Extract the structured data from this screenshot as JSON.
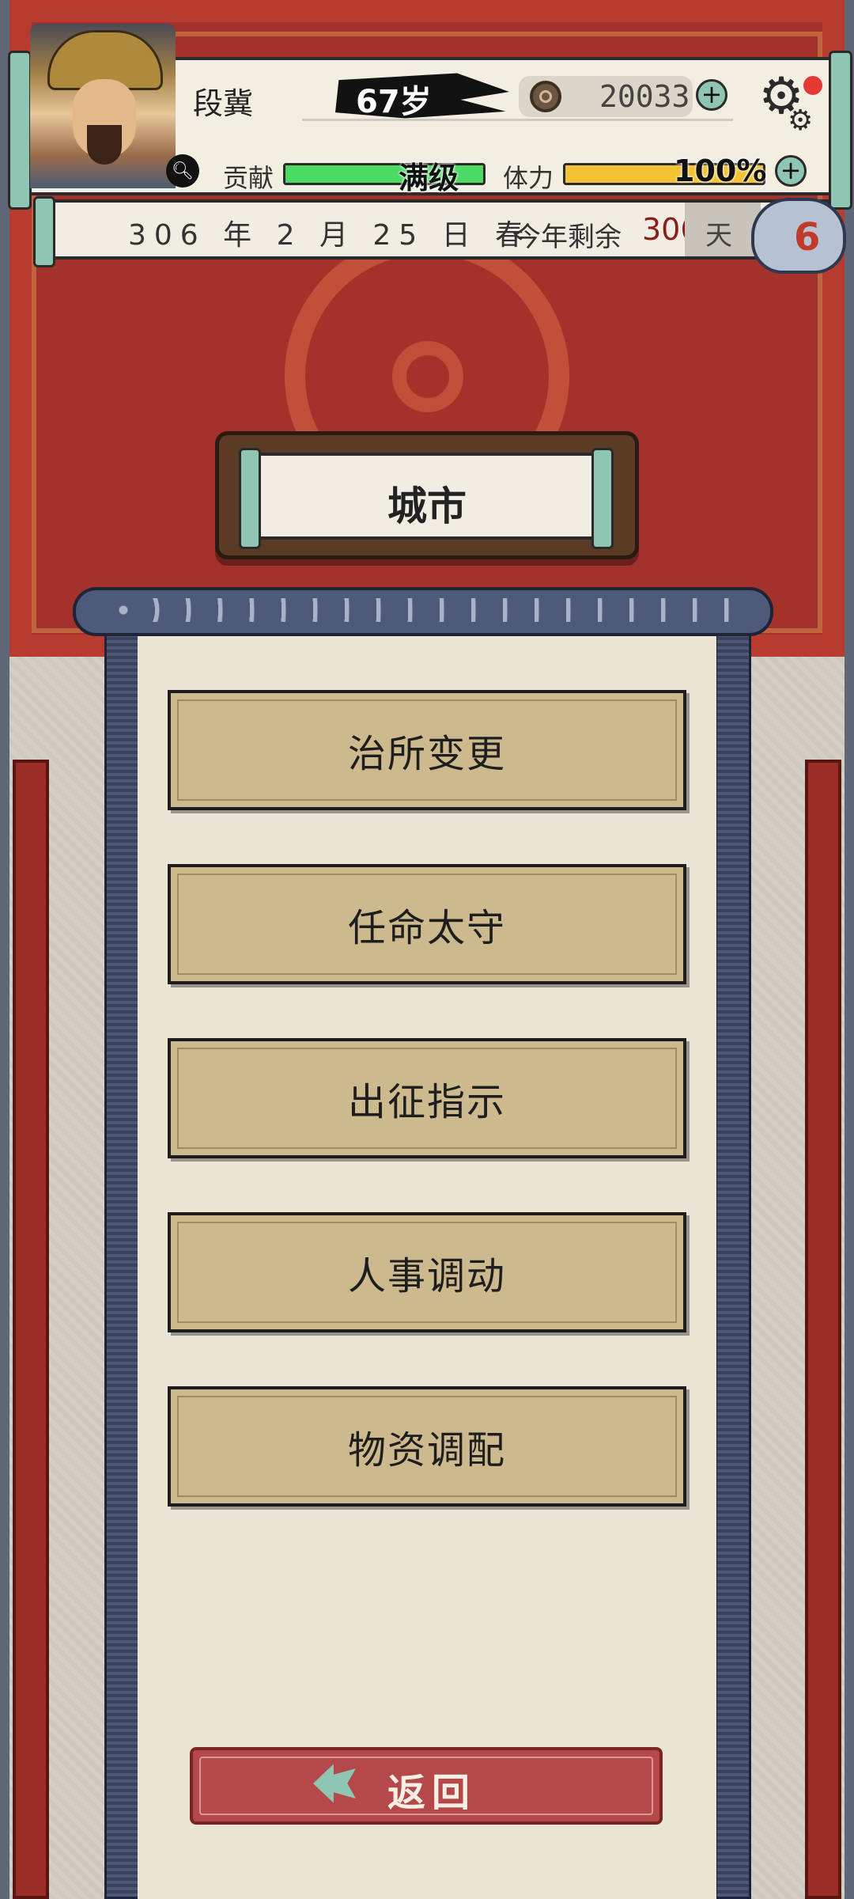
{
  "player": {
    "name": "段冀",
    "age": "67岁",
    "coins": "20033",
    "contribution_label": "贡献",
    "contribution_value": "满级",
    "contribution_fill": 1.0,
    "stamina_label": "体力",
    "stamina_value": "100%",
    "stamina_fill": 1.0
  },
  "date": {
    "text": "306 年 2 月 25 日 春",
    "remaining_label": "今年剩余",
    "remaining_days": "306",
    "remaining_unit": "天"
  },
  "badge_count": "6",
  "page_title": "城市",
  "menu": [
    {
      "label": "治所变更"
    },
    {
      "label": "任命太守"
    },
    {
      "label": "出征指示"
    },
    {
      "label": "人事调动"
    },
    {
      "label": "物资调配"
    }
  ],
  "back_label": "返回",
  "colors": {
    "contribution_bar": "#4cd964",
    "stamina_bar": "#f2c232",
    "accent_teal": "#8fc5b3",
    "banner_red": "#a3322a"
  }
}
